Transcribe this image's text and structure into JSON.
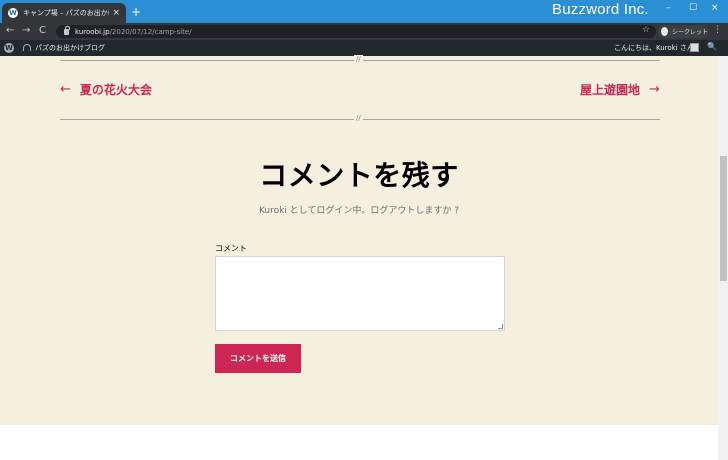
{
  "browser": {
    "tab_title": "キャンプ場 – パズのお出かけブログ",
    "tab_favicon": "W",
    "tab_close": "×",
    "new_tab": "+",
    "brand": "Buzzword Inc.",
    "minimize": "–",
    "maximize": "☐",
    "close": "×",
    "back": "←",
    "forward": "→",
    "reload": "C",
    "url_host": "kuroobi.jp",
    "url_path": "/2020/07/12/camp-site/",
    "bookmark_star": "☆",
    "incognito_label": "シークレット",
    "menu": "⋮"
  },
  "adminbar": {
    "logo": "W",
    "site_name": "パズのお出かけブログ",
    "howdy": "こんにちは、Kuroki さん",
    "search": "🔍"
  },
  "content": {
    "divider_mark": "//",
    "prev_arrow": "←",
    "prev_label": "夏の花火大会",
    "next_label": "屋上遊園地",
    "next_arrow": "→",
    "heading": "コメントを残す",
    "logged_in": "Kuroki としてログイン中。ログアウトしますか ?",
    "comment_label": "コメント",
    "comment_value": "",
    "submit_label": "コメントを送信"
  },
  "colors": {
    "accent": "#cd2653",
    "background": "#f5efe0",
    "titlebar": "#2b8fd6",
    "adminbar": "#23282d"
  }
}
